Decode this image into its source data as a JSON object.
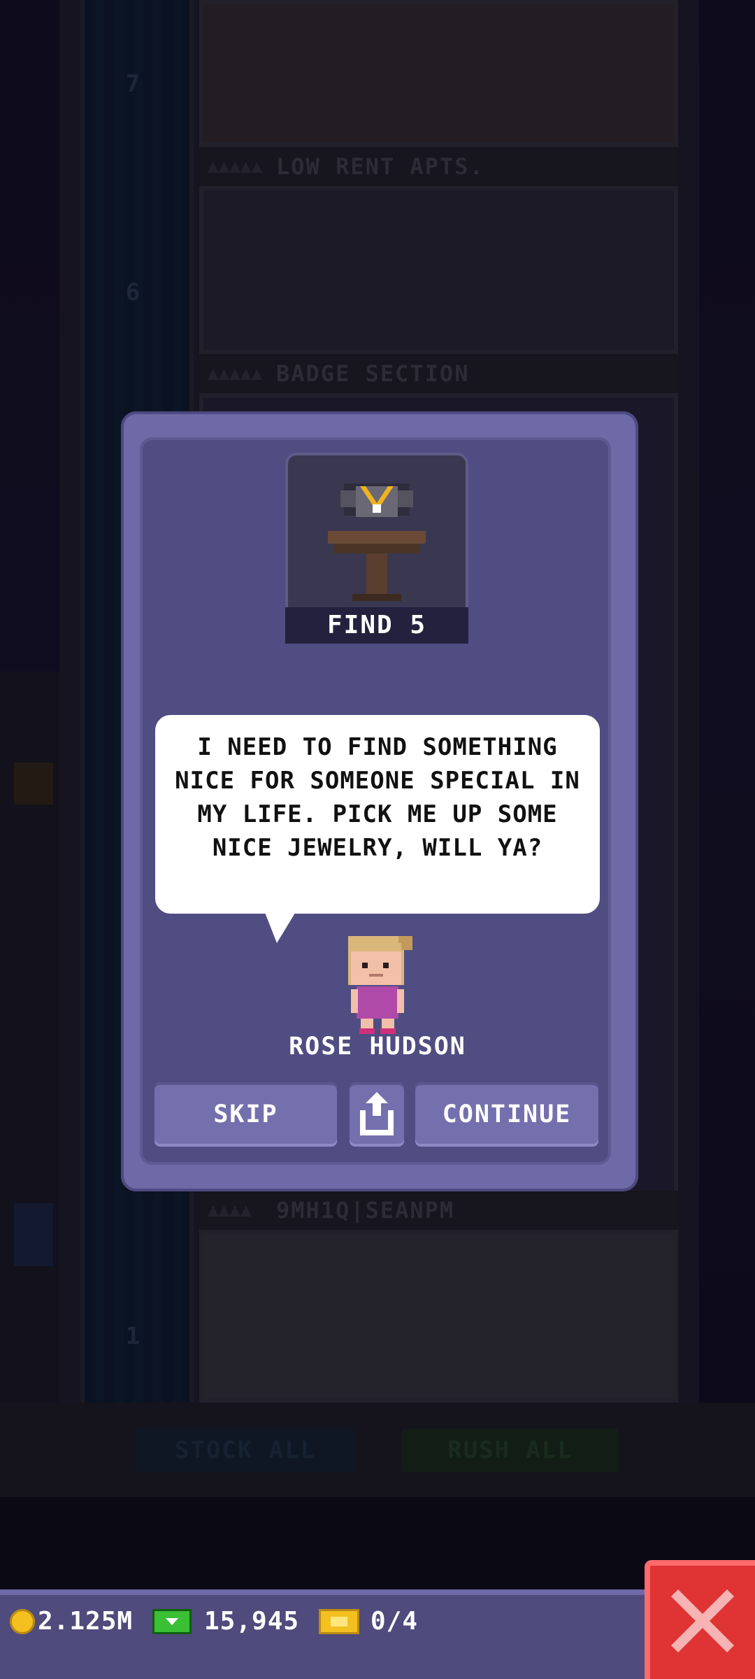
{
  "tower": {
    "floors": [
      {
        "number": "7",
        "label": "LOW RENT APTS."
      },
      {
        "number": "6",
        "label": "BADGE SECTION"
      },
      {
        "number": "1",
        "label": "9MH1Q|SEANPM"
      }
    ],
    "buttons": {
      "stock_all": "STOCK ALL",
      "rush_all": "RUSH ALL"
    }
  },
  "modal": {
    "badge_caption": "FIND 5",
    "speech": "I NEED TO FIND SOMETHING NICE FOR SOMEONE SPECIAL IN MY LIFE. PICK ME UP SOME NICE JEWELRY, WILL YA?",
    "character_name": "ROSE HUDSON",
    "buttons": {
      "skip": "SKIP",
      "share_icon": "share-icon",
      "continue": "CONTINUE"
    }
  },
  "status_bar": {
    "coins": "2.125M",
    "bux": "15,945",
    "tickets": "0/4",
    "close_icon": "close-icon"
  },
  "colors": {
    "modal_frame": "#6e6aa8",
    "modal_inner": "#4f4d82",
    "button": "#7470ae",
    "close_button": "#e03434",
    "coin": "#f4c020",
    "bux": "#3bbf34"
  }
}
